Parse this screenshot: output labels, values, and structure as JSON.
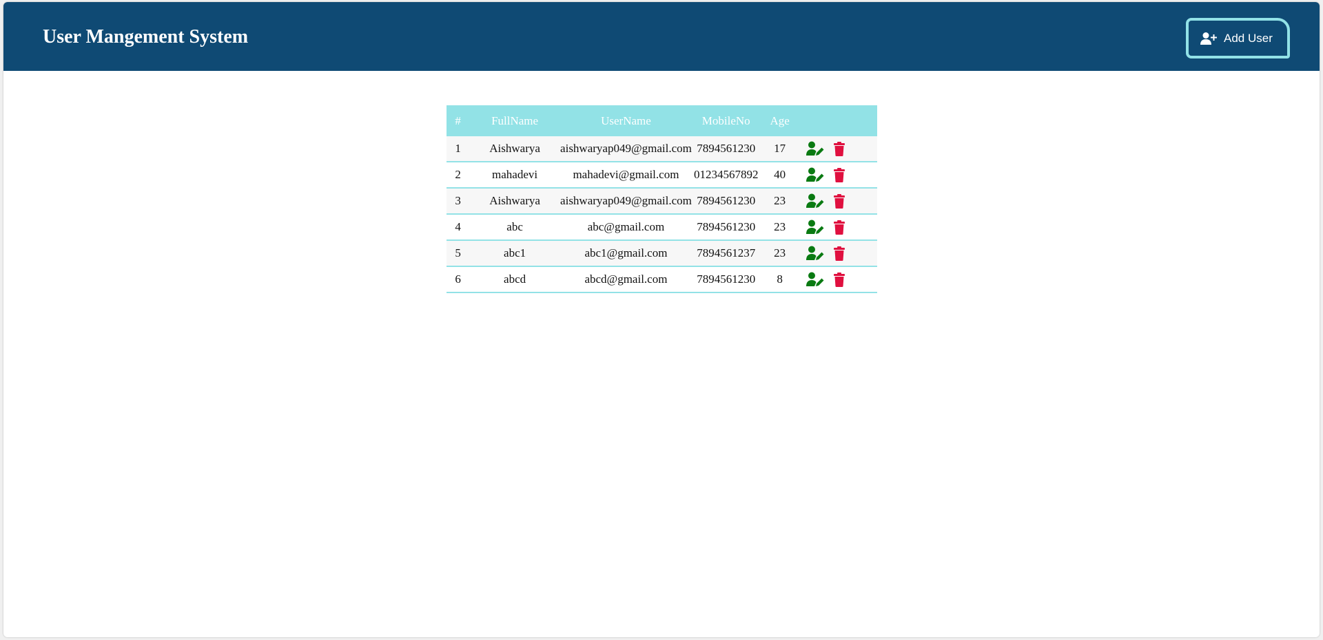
{
  "header": {
    "title": "User Mangement System",
    "add_user_label": "Add User"
  },
  "table": {
    "columns": [
      "#",
      "FullName",
      "UserName",
      "MobileNo",
      "Age",
      ""
    ],
    "rows": [
      {
        "num": "1",
        "fullname": "Aishwarya",
        "username": "aishwaryap049@gmail.com",
        "mobile": "7894561230",
        "age": "17"
      },
      {
        "num": "2",
        "fullname": "mahadevi",
        "username": "mahadevi@gmail.com",
        "mobile": "01234567892",
        "age": "40"
      },
      {
        "num": "3",
        "fullname": "Aishwarya",
        "username": "aishwaryap049@gmail.com",
        "mobile": "7894561230",
        "age": "23"
      },
      {
        "num": "4",
        "fullname": "abc",
        "username": "abc@gmail.com",
        "mobile": "7894561230",
        "age": "23"
      },
      {
        "num": "5",
        "fullname": "abc1",
        "username": "abc1@gmail.com",
        "mobile": "7894561237",
        "age": "23"
      },
      {
        "num": "6",
        "fullname": "abcd",
        "username": "abcd@gmail.com",
        "mobile": "7894561230",
        "age": "8"
      }
    ]
  },
  "colors": {
    "header_bg": "#0f4a74",
    "table_header_bg": "#92e2e6",
    "edit_icon": "#0a7a12",
    "delete_icon": "#e0103f"
  },
  "icons": {
    "add_user": "user-plus-icon",
    "edit": "user-edit-icon",
    "delete": "trash-icon"
  }
}
